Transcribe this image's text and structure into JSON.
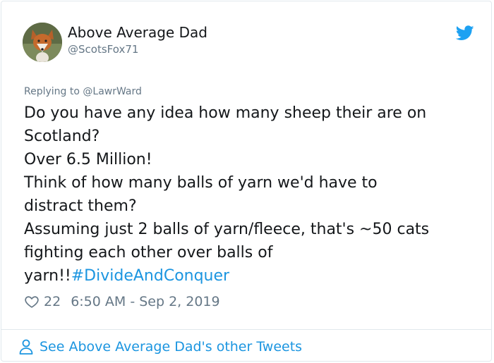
{
  "author": {
    "display_name": "Above Average Dad",
    "handle": "@ScotsFox71",
    "avatar_icon": "fox-avatar"
  },
  "reply": {
    "prefix": "Replying to ",
    "to": "@LawrWard"
  },
  "tweet": {
    "lines": [
      "Do you have any idea how many sheep their are on",
      "Scotland?",
      "Over 6.5 Million!",
      "Think of how many balls of yarn we'd have to",
      "distract them?",
      "Assuming just 2 balls of yarn/fleece, that's ~50 cats",
      "fighting each other over balls of"
    ],
    "last_line_text": "yarn!!",
    "hashtag": "#DivideAndConquer"
  },
  "meta": {
    "like_count": "22",
    "timestamp": "6:50 AM - Sep 2, 2019",
    "heart_icon": "heart-icon"
  },
  "footer": {
    "label": "See Above Average Dad's other Tweets",
    "icon": "person-icon"
  },
  "colors": {
    "accent": "#1b95e0",
    "twitter_blue": "#1da1f2",
    "secondary_text": "#657786",
    "border": "#e1e8ed"
  }
}
